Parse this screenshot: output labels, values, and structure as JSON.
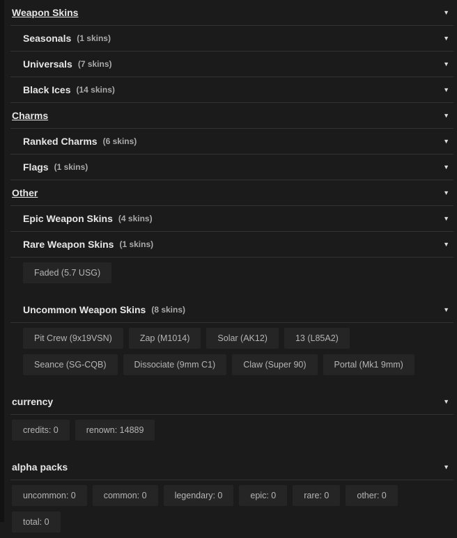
{
  "sections": [
    {
      "title": "Weapon Skins",
      "subs": [
        {
          "title": "Seasonals",
          "count": "(1 skins)"
        },
        {
          "title": "Universals",
          "count": "(7 skins)"
        },
        {
          "title": "Black Ices",
          "count": "(14 skins)"
        }
      ]
    },
    {
      "title": "Charms",
      "subs": [
        {
          "title": "Ranked Charms",
          "count": "(6 skins)"
        },
        {
          "title": "Flags",
          "count": "(1 skins)"
        }
      ]
    },
    {
      "title": "Other",
      "subs": [
        {
          "title": "Epic Weapon Skins",
          "count": "(4 skins)"
        },
        {
          "title": "Rare Weapon Skins",
          "count": "(1 skins)",
          "items": [
            "Faded (5.7 USG)"
          ]
        },
        {
          "title": "Uncommon Weapon Skins",
          "count": "(8 skins)",
          "items": [
            "Pit Crew (9x19VSN)",
            "Zap (M1014)",
            "Solar (AK12)",
            "13 (L85A2)",
            "Seance (SG-CQB)",
            "Dissociate (9mm C1)",
            "Claw (Super 90)",
            "Portal (Mk1 9mm)"
          ]
        }
      ]
    }
  ],
  "currency": {
    "title": "currency",
    "items": [
      "credits: 0",
      "renown: 14889"
    ]
  },
  "alpha_packs": {
    "title": "alpha packs",
    "items": [
      "uncommon: 0",
      "common: 0",
      "legendary: 0",
      "epic: 0",
      "rare: 0",
      "other: 0",
      "total: 0"
    ]
  },
  "icons": {
    "expand": "▼"
  }
}
